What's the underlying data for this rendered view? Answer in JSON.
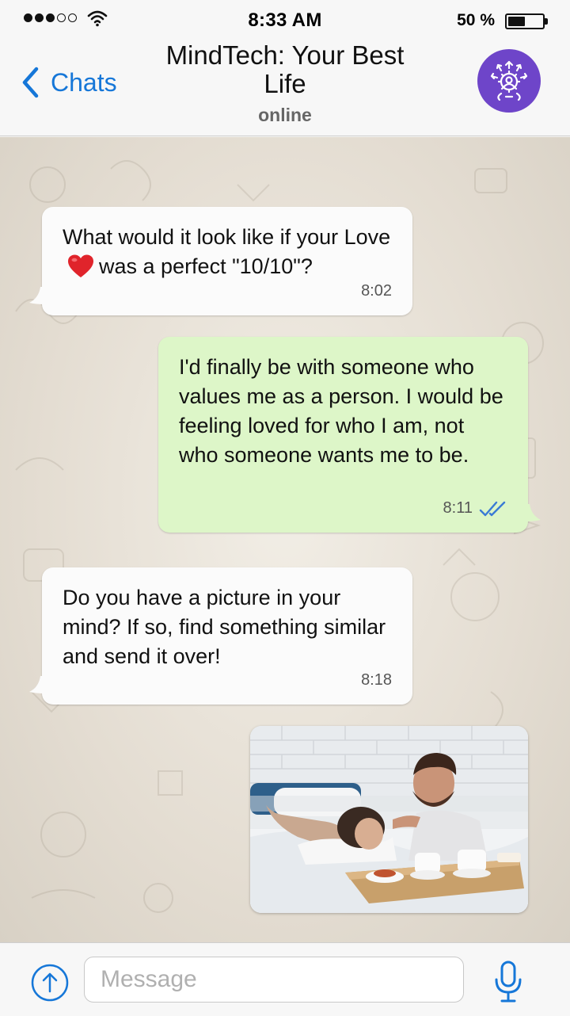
{
  "status_bar": {
    "time": "8:33 AM",
    "battery_percent_label": "50 %",
    "battery_level": 0.5,
    "signal_bars_filled": 3,
    "signal_bars_total": 5
  },
  "header": {
    "back_label": "Chats",
    "title": "MindTech: Your Best Life",
    "status": "online",
    "avatar_icon": "network-gear-person-icon",
    "avatar_color": "#6e45c9"
  },
  "messages": [
    {
      "direction": "incoming",
      "text_before_emoji": "What would it look like if your Love",
      "emoji": "red-heart",
      "text_after_emoji": "was a perfect \"10/10\"?",
      "time": "8:02"
    },
    {
      "direction": "outgoing",
      "text": "I'd finally be with someone who values me as a person. I would be feeling loved for who I am, not who someone wants me to be.",
      "time": "8:11",
      "read_receipt": "double-check-icon"
    },
    {
      "direction": "incoming",
      "text": "Do you have a picture in your mind? If so, find something similar and send it over!",
      "time": "8:18"
    },
    {
      "direction": "outgoing",
      "type": "image"
    }
  ],
  "composer": {
    "placeholder": "Message",
    "value": ""
  },
  "colors": {
    "accent": "#1677d8",
    "incoming_bubble": "#fbfbfb",
    "outgoing_bubble": "#ddf6c8",
    "chat_background": "#e4ddd2"
  }
}
